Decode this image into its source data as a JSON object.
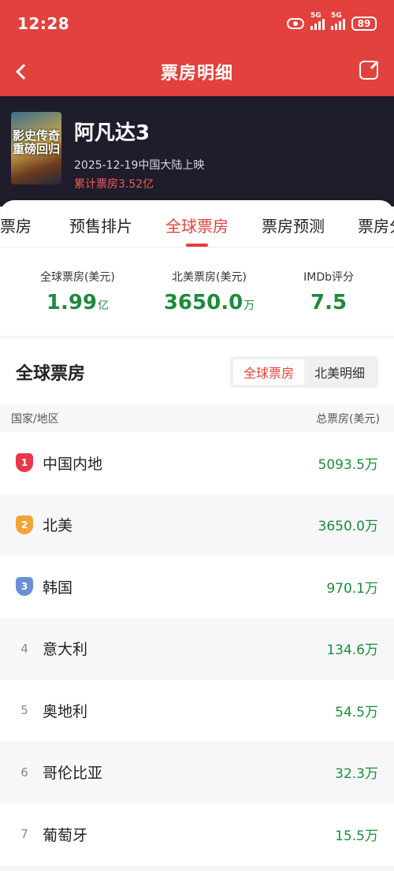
{
  "status_bar": {
    "time": "12:28",
    "signal1_label": "5G",
    "signal2_label": "5G",
    "battery": "89"
  },
  "header": {
    "title": "票房明细",
    "back_icon": "chevron-left-icon",
    "share_icon": "share-icon"
  },
  "movie": {
    "title": "阿凡达3",
    "release": "2025-12-19中国大陆上映",
    "cumulative_box_office": "累计票房3.52亿",
    "poster_text": "影史传奇 重磅回归"
  },
  "tabs": [
    {
      "label": "用票房"
    },
    {
      "label": "预售排片"
    },
    {
      "label": "全球票房"
    },
    {
      "label": "票房预测"
    },
    {
      "label": "票房分"
    }
  ],
  "active_tab": 2,
  "stats": [
    {
      "label": "全球票房(美元)",
      "value": "1.99",
      "unit": "亿"
    },
    {
      "label": "北美票房(美元)",
      "value": "3650.0",
      "unit": "万"
    },
    {
      "label": "IMDb评分",
      "value": "7.5",
      "unit": ""
    }
  ],
  "section": {
    "title": "全球票房",
    "toggle": [
      "全球票房",
      "北美明细"
    ],
    "col_country": "国家/地区",
    "col_total": "总票房(美元)"
  },
  "rows": [
    {
      "rank": "1",
      "country": "中国内地",
      "value": "5093.5万"
    },
    {
      "rank": "2",
      "country": "北美",
      "value": "3650.0万"
    },
    {
      "rank": "3",
      "country": "韩国",
      "value": "970.1万"
    },
    {
      "rank": "4",
      "country": "意大利",
      "value": "134.6万"
    },
    {
      "rank": "5",
      "country": "奥地利",
      "value": "54.5万"
    },
    {
      "rank": "6",
      "country": "哥伦比亚",
      "value": "32.3万"
    },
    {
      "rank": "7",
      "country": "葡萄牙",
      "value": "15.5万"
    }
  ],
  "colors": {
    "brand_red": "#e2413d",
    "value_green": "#1f8a3b",
    "rank1": "#e8384a",
    "rank2": "#f2a43a",
    "rank3": "#6b8fd6"
  }
}
